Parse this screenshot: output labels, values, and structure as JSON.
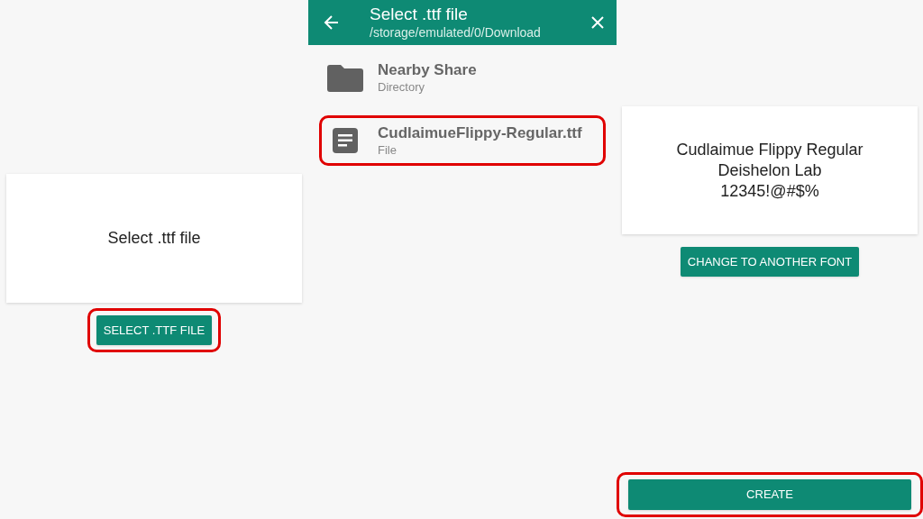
{
  "screens": [
    {
      "kind": "start",
      "card_text": "Select .ttf file",
      "button": {
        "label": "SELECT .TTF FILE",
        "highlighted": true
      }
    },
    {
      "kind": "picker",
      "title": "Select .ttf file",
      "path": "/storage/emulated/0/Download",
      "items": [
        {
          "kind": "folder",
          "name": "Nearby Share",
          "type": "Directory",
          "highlighted": false
        },
        {
          "kind": "file",
          "name": "CudlaimueFlippy-Regular.ttf",
          "type": "File",
          "highlighted": true
        }
      ]
    },
    {
      "kind": "preview",
      "preview_lines": [
        "Cudlaimue Flippy Regular",
        "Deishelon Lab",
        "12345!@#$%"
      ],
      "button": {
        "label": "CHANGE TO ANOTHER FONT",
        "highlighted": false
      },
      "create_button": {
        "label": "CREATE",
        "highlighted": true
      }
    }
  ]
}
